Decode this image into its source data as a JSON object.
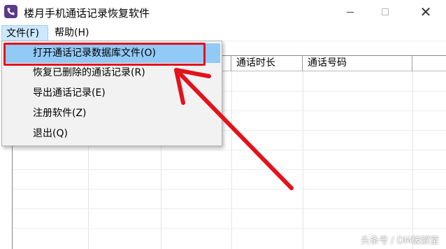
{
  "window": {
    "title": "楼月手机通话记录恢复软件",
    "close_glyph": "✕"
  },
  "menubar": {
    "file": "文件(F)",
    "help": "帮助(H)"
  },
  "file_menu": {
    "items": [
      "打开通话记录数据库文件(O)",
      "恢复已删除的通话记录(R)",
      "导出通话记录(E)",
      "注册软件(Z)",
      "退出(Q)"
    ],
    "highlighted_index": 0
  },
  "list": {
    "columns": [
      "",
      "",
      "",
      "通话时长",
      "通话号码",
      ""
    ]
  },
  "annotation": {
    "box_color": "#e3121b",
    "arrow_color": "#e3121b"
  },
  "watermark": "头条号 / DM破解室",
  "colors": {
    "menu_highlight": "#91c9f7",
    "menubar_active": "#cce8ff",
    "app_icon": "#5b3a86"
  }
}
